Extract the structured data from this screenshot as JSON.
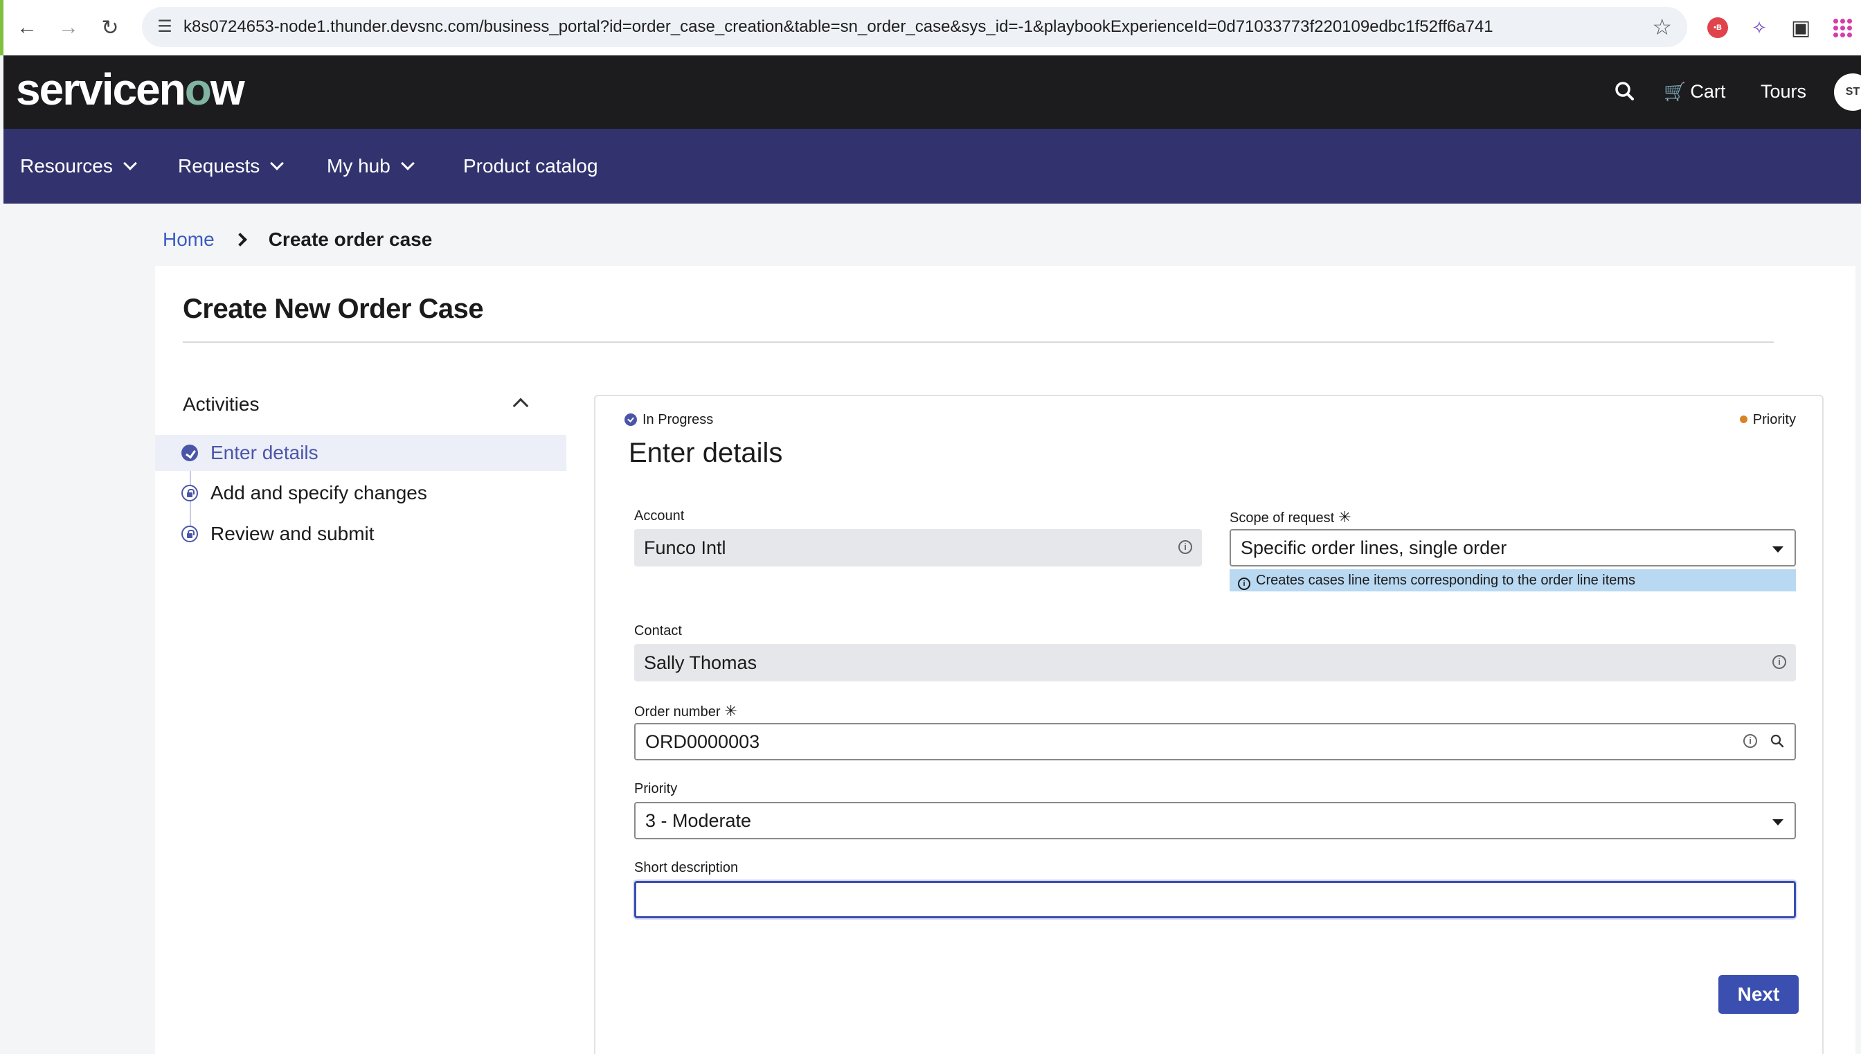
{
  "browser": {
    "url": "k8s0724653-node1.thunder.devsnc.com/business_portal?id=order_case_creation&table=sn_order_case&sys_id=-1&playbookExperienceId=0d71033773f220109edbc1f52ff6a741",
    "extension_badge": "•B"
  },
  "header": {
    "logo_text_1": "servicen",
    "logo_text_2": "o",
    "logo_text_3": "w",
    "cart_label": "Cart",
    "tours_label": "Tours",
    "avatar_initials": "ST"
  },
  "nav": {
    "items": [
      {
        "label": "Resources"
      },
      {
        "label": "Requests"
      },
      {
        "label": "My hub"
      },
      {
        "label": "Product catalog"
      }
    ]
  },
  "breadcrumb": {
    "home": "Home",
    "current": "Create order case"
  },
  "page": {
    "title": "Create New Order Case"
  },
  "activities": {
    "heading": "Activities",
    "items": [
      {
        "label": "Enter details",
        "state": "active"
      },
      {
        "label": "Add and specify changes",
        "state": "locked"
      },
      {
        "label": "Review and submit",
        "state": "locked"
      }
    ]
  },
  "form": {
    "status": "In Progress",
    "priority_tag": "Priority",
    "section_title": "Enter details",
    "account": {
      "label": "Account",
      "value": "Funco Intl"
    },
    "scope": {
      "label": "Scope of request",
      "value": "Specific order lines, single order",
      "helper": "Creates cases line items corresponding to the order line items"
    },
    "contact": {
      "label": "Contact",
      "value": "Sally Thomas"
    },
    "order_number": {
      "label": "Order number",
      "value": "ORD0000003"
    },
    "priority": {
      "label": "Priority",
      "value": "3 - Moderate"
    },
    "short_description": {
      "label": "Short description",
      "value": ""
    },
    "required_mark": "✳",
    "info_glyph": "i",
    "next_label": "Next"
  },
  "colors": {
    "nav_bg": "#32336e",
    "header_bg": "#1c1c1e",
    "accent": "#3b4fb0",
    "helper_bg": "#b9d8f1",
    "priority_dot": "#d98324"
  }
}
